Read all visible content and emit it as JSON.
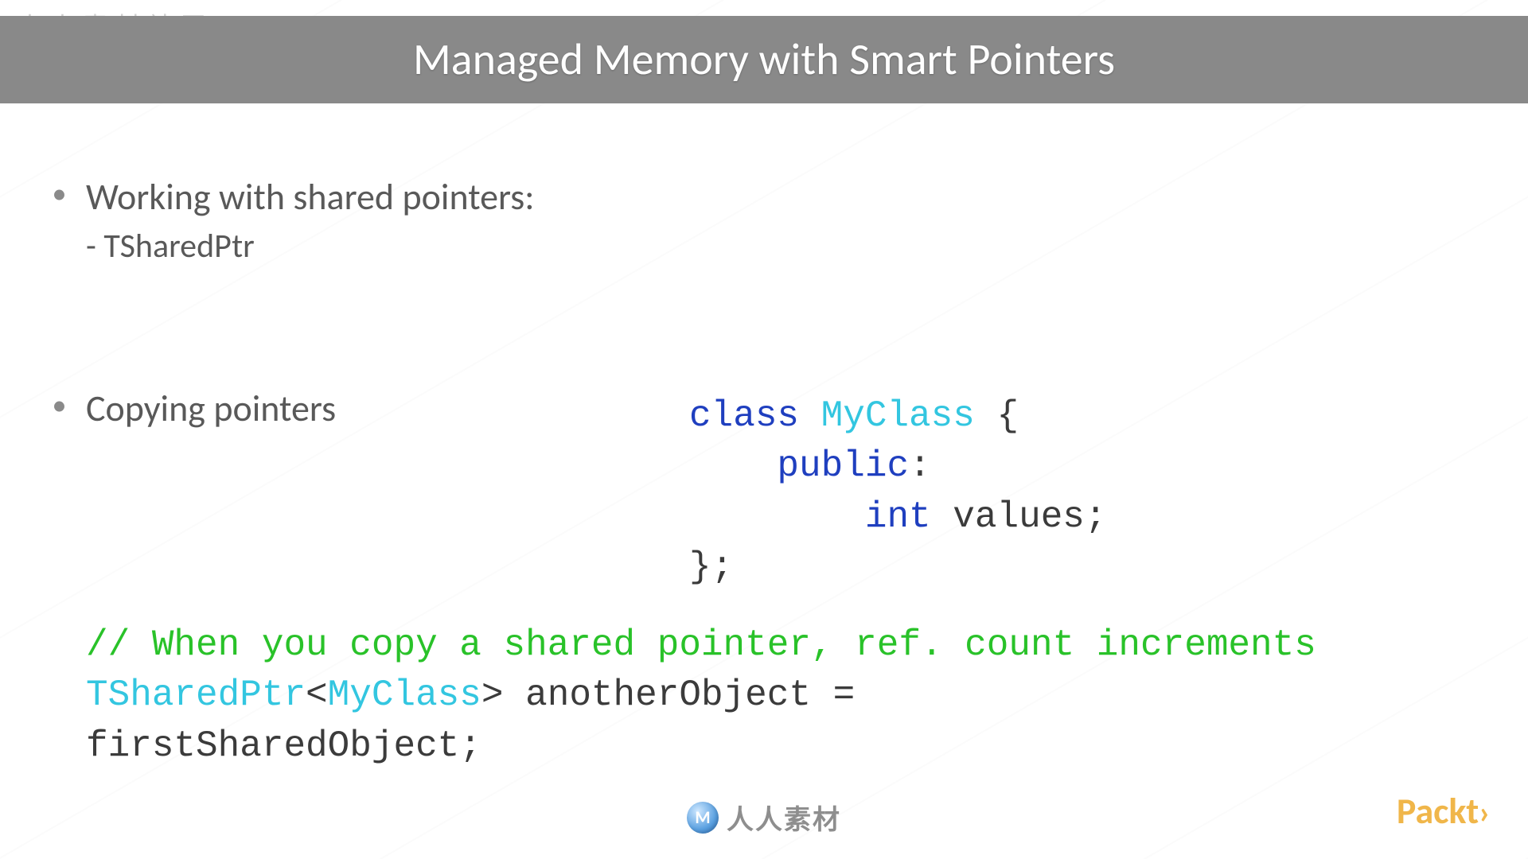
{
  "watermark_top": "人人素材社区",
  "title": "Managed Memory with Smart Pointers",
  "bullets": {
    "b1": "Working with shared pointers:",
    "b1_sub": "- TSharedPtr",
    "b2": "Copying pointers"
  },
  "class_code": {
    "l1_kw": "class",
    "l1_name": "MyClass",
    "l1_brace": " {",
    "l2_indent": "    ",
    "l2_kw": "public",
    "l2_colon": ":",
    "l3_indent": "        ",
    "l3_kw": "int",
    "l3_rest": " values;",
    "l4": "};"
  },
  "copy_code": {
    "c1": "// When you copy a shared pointer, ref. count increments",
    "c2_type": "TSharedPtr",
    "c2_lt": "<",
    "c2_param": "MyClass",
    "c2_gt": ">",
    "c2_rest": " anotherObject = ",
    "c3": "firstSharedObject;"
  },
  "footer": {
    "icon_letter": "M",
    "center_text": "人人素材",
    "brand": "Packt",
    "brand_angle": "›"
  }
}
